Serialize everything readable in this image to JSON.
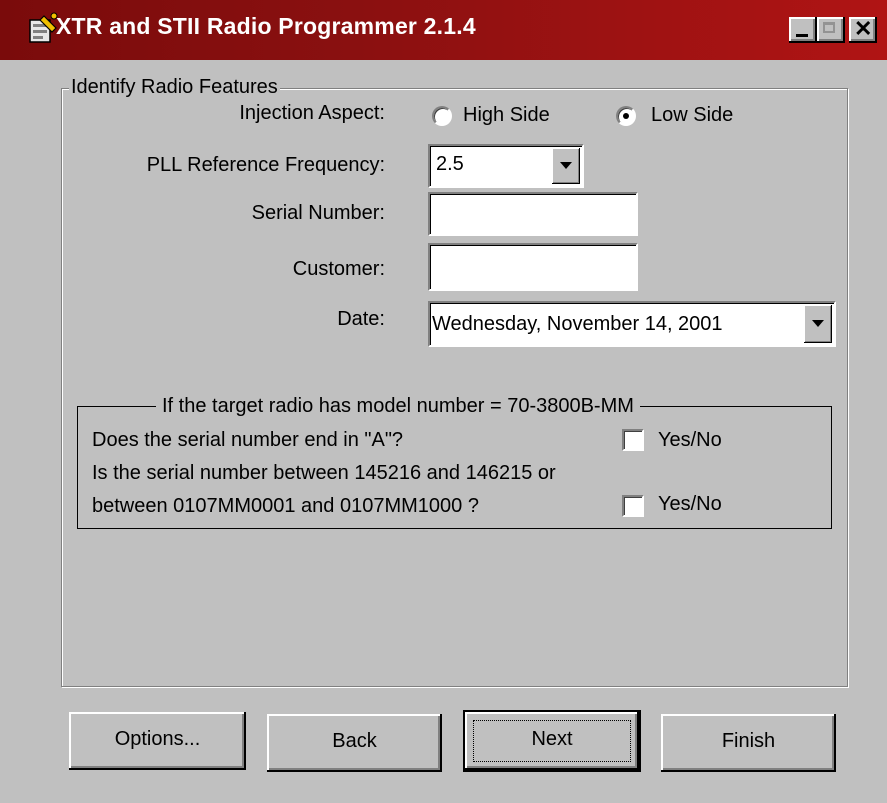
{
  "window": {
    "title": "XTR and STII Radio Programmer 2.1.4",
    "icon": "app-wrench-icon",
    "controls": {
      "minimize": "minimize-icon",
      "maximize": "maximize-icon",
      "close": "✕"
    }
  },
  "features_group": {
    "legend": "Identify Radio Features",
    "injection": {
      "label": "Injection Aspect:",
      "options": [
        "High Side",
        "Low Side"
      ],
      "selected": "Low Side"
    },
    "pll": {
      "label": "PLL Reference Frequency:",
      "value": "2.5"
    },
    "serial": {
      "label": "Serial Number:",
      "value": ""
    },
    "customer": {
      "label": "Customer:",
      "value": ""
    },
    "date": {
      "label": "Date:",
      "value": "Wednesday, November  14, 2001"
    }
  },
  "model_group": {
    "legend": "If the target radio has model number = 70-3800B-MM",
    "q1": {
      "text": "Does the serial number end in \"A\"?",
      "checkbox_label": "Yes/No",
      "checked": false
    },
    "q2": {
      "line1": "Is the serial number between 145216 and 146215 or",
      "line2": "between 0107MM0001 and 0107MM1000 ?",
      "checkbox_label": "Yes/No",
      "checked": false
    }
  },
  "buttons": {
    "options": "Options...",
    "back": "Back",
    "next": "Next",
    "finish": "Finish"
  },
  "colors": {
    "titlebar": "#8a1010",
    "face": "#c0c0c0"
  }
}
